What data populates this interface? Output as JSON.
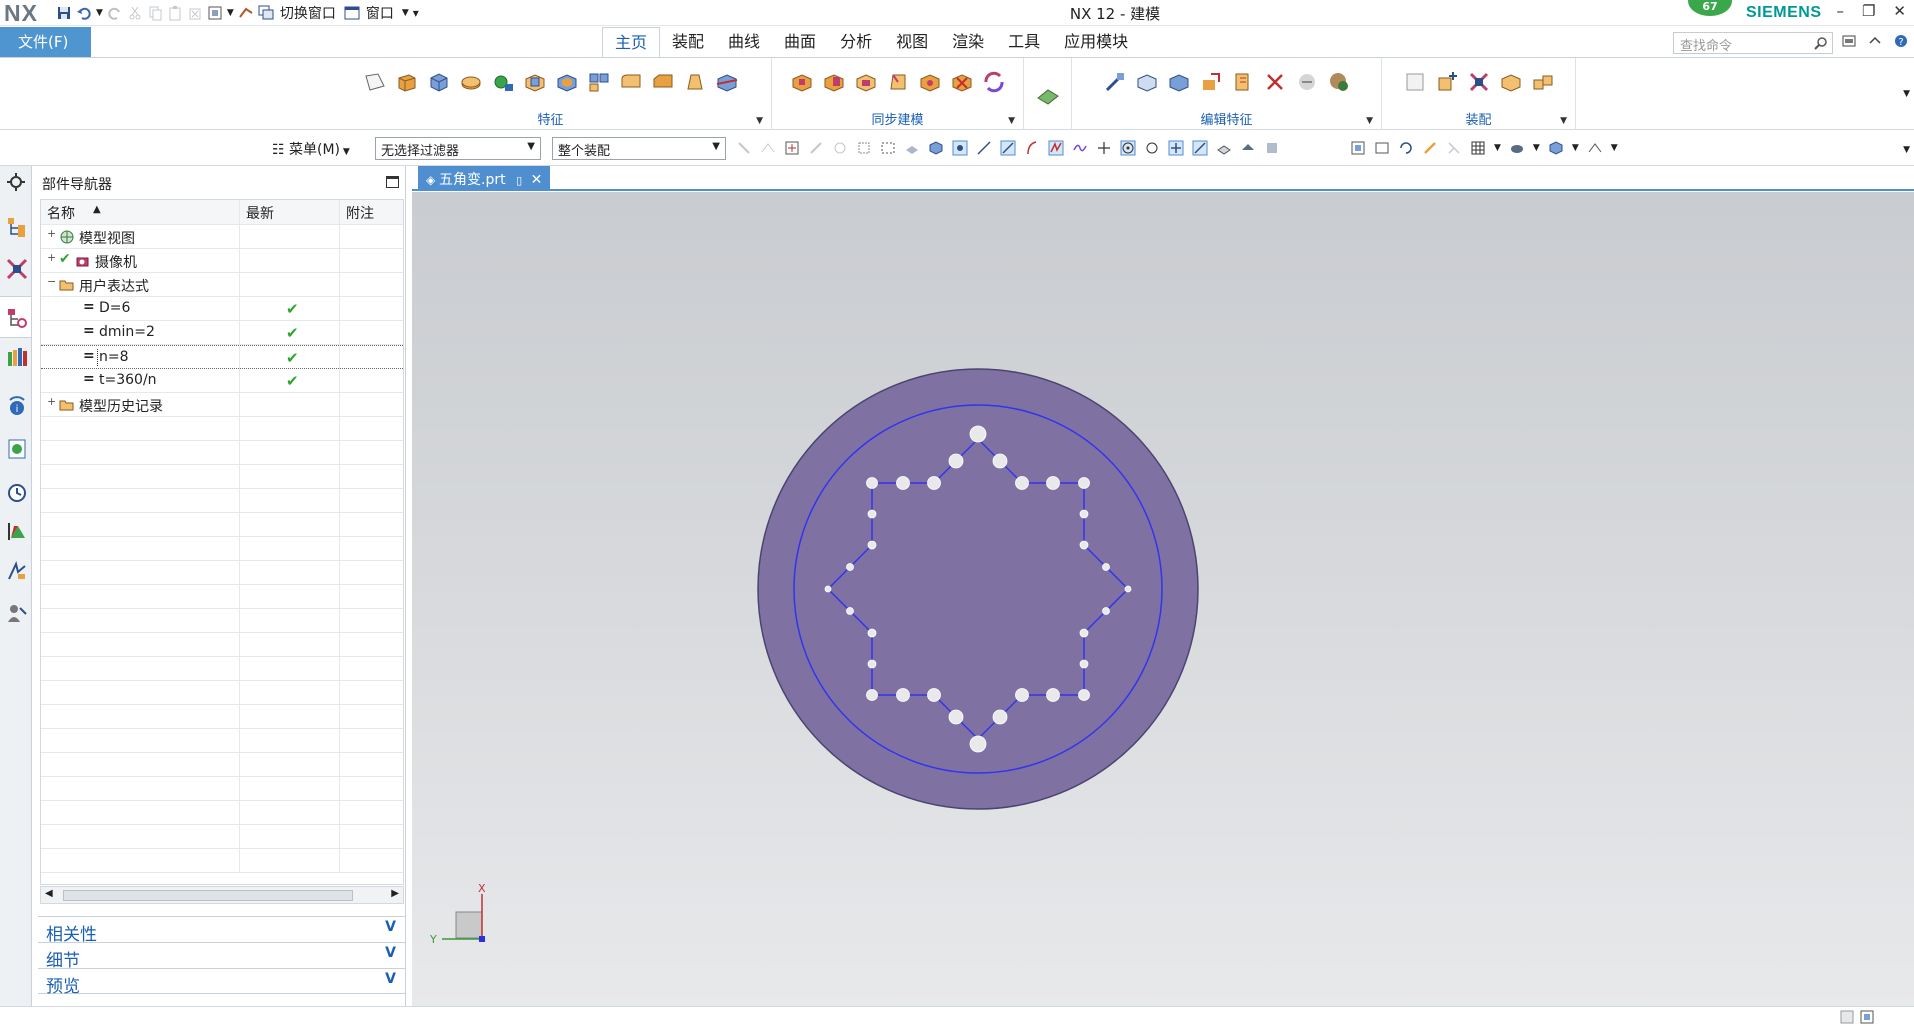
{
  "app": {
    "logo": "NX",
    "window_title": "NX 12 - 建模",
    "brand": "SIEMENS",
    "badge_count": "67"
  },
  "quick_access": {
    "switch_window": "切换窗口",
    "window": "窗口"
  },
  "ribbon": {
    "file": "文件(F)",
    "tabs": [
      "主页",
      "装配",
      "曲线",
      "曲面",
      "分析",
      "视图",
      "渲染",
      "工具",
      "应用模块"
    ],
    "active_tab": "主页",
    "search_placeholder": "查找命令",
    "groups": [
      "特征",
      "同步建模",
      "编辑特征",
      "装配"
    ]
  },
  "toolbar2": {
    "menu": "菜单(M)",
    "filter": "无选择过滤器",
    "scope": "整个装配"
  },
  "navigator": {
    "title": "部件导航器",
    "columns": [
      "名称",
      "最新",
      "附注"
    ],
    "rows": [
      {
        "label": "模型视图",
        "level": 0,
        "expander": "+",
        "check": ""
      },
      {
        "label": "摄像机",
        "level": 0,
        "expander": "+",
        "check": "✔"
      },
      {
        "label": "用户表达式",
        "level": 0,
        "expander": "−",
        "check": ""
      },
      {
        "label": "D=6",
        "level": 1,
        "expander": "",
        "check": "✔"
      },
      {
        "label": "dmin=2",
        "level": 1,
        "expander": "",
        "check": "✔"
      },
      {
        "label": "n=8",
        "level": 1,
        "expander": "",
        "check": "✔"
      },
      {
        "label": "t=360/n",
        "level": 1,
        "expander": "",
        "check": "✔"
      },
      {
        "label": "模型历史记录",
        "level": 0,
        "expander": "+",
        "check": ""
      }
    ],
    "sections": [
      "相关性",
      "细节",
      "预览"
    ]
  },
  "graphics": {
    "tab_label": "五角变.prt",
    "triad_x": "X",
    "triad_y": "Y"
  },
  "colors": {
    "accent": "#4f95d0",
    "part_fill": "#7f72a3",
    "sketch_curve": "#3333ee",
    "check": "#2fa52f",
    "brand": "#009999"
  }
}
